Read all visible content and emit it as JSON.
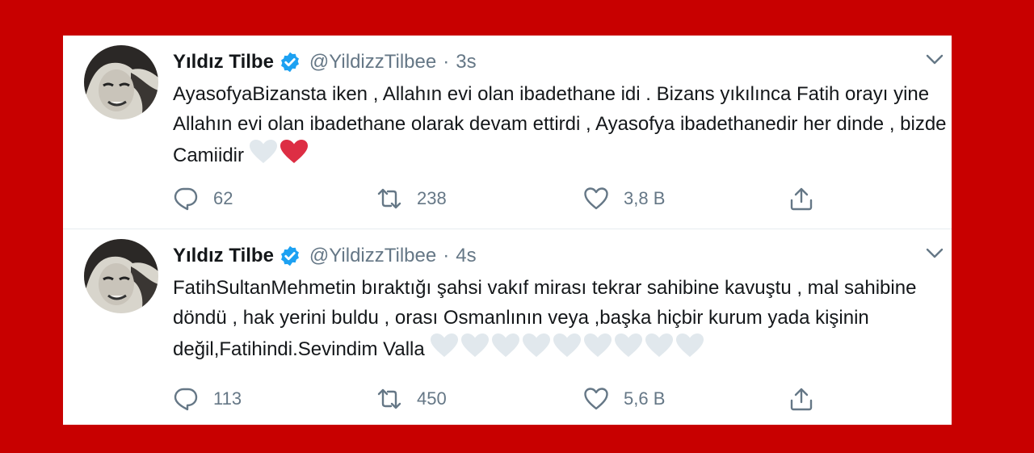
{
  "tweets": [
    {
      "name": "Yıldız Tilbe",
      "handle": "@YildizzTilbee",
      "separator": "·",
      "time": "3s",
      "text": "AyasofyaBizansta iken , Allahın evi olan  ibadethane idi . Bizans yıkılınca Fatih orayı yine Allahın evi olan ibadethane olarak devam ettirdi , Ayasofya ibadethanedir her dinde , bizde Camiidir",
      "emoji": [
        "white-heart",
        "red-heart"
      ],
      "replies": "62",
      "retweets": "238",
      "likes": "3,8 B"
    },
    {
      "name": "Yıldız Tilbe",
      "handle": "@YildizzTilbee",
      "separator": "·",
      "time": "4s",
      "text": "FatihSultanMehmetin bıraktığı şahsi vakıf mirası tekrar sahibine kavuştu , mal sahibine döndü , hak yerini buldu , orası Osmanlının veya ,başka hiçbir kurum yada kişinin değil,Fatihindi.Sevindim Valla",
      "emoji": [
        "white-heart",
        "white-heart",
        "white-heart",
        "white-heart",
        "white-heart",
        "white-heart",
        "white-heart",
        "white-heart",
        "white-heart"
      ],
      "replies": "113",
      "retweets": "450",
      "likes": "5,6 B"
    }
  ],
  "icons": {
    "verified": "verified-badge-icon",
    "caret": "chevron-down-icon",
    "reply": "reply-icon",
    "retweet": "retweet-icon",
    "like": "heart-icon",
    "share": "share-icon"
  },
  "colors": {
    "background": "#c80000",
    "panel": "#ffffff",
    "verified": "#1da1f2",
    "secondary_text": "#657786",
    "red_heart": "#dd2e44",
    "white_heart": "#e1e8ed"
  }
}
